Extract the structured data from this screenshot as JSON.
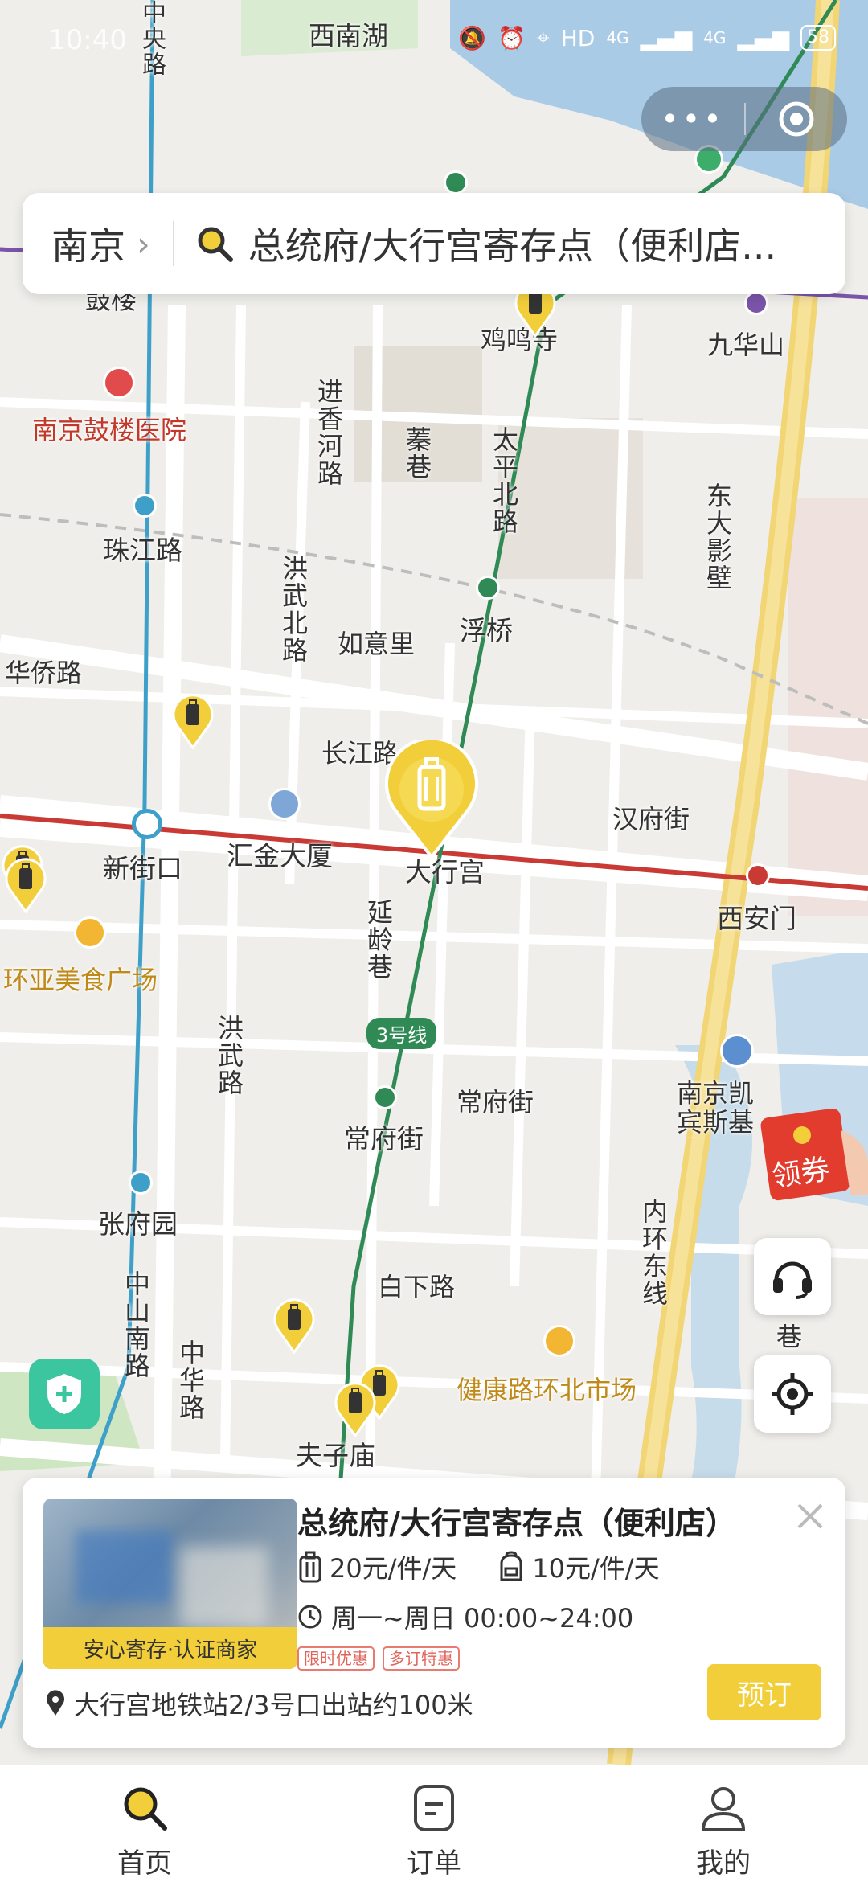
{
  "status_bar": {
    "time": "10:40",
    "network": "HD",
    "signal_a": "4G",
    "signal_b": "4G",
    "battery": "58"
  },
  "search": {
    "city": "南京",
    "query": "总统府/大行宫寄存点（便利店..."
  },
  "map_labels": {
    "xinanhu": "西南湖",
    "zhongyanglu": "中央路",
    "gulou": "鼓楼",
    "jimingsi": "鸡鸣寺",
    "jiuhuashan": "九华山",
    "gulou_hospital": "南京鼓楼医院",
    "jinxianghe": "进香河路",
    "qinxiang": "蓁巷",
    "taipingbei": "太平北路",
    "dongdayingbi": "东大影壁",
    "zhujianglu": "珠江路",
    "hongwubei": "洪武北路",
    "ruyili": "如意里",
    "fuqiao": "浮桥",
    "huaqiaolu": "华侨路",
    "changjianglu": "长江路",
    "hanfujie": "汉府街",
    "xinjiekou": "新街口",
    "huijin": "汇金大厦",
    "daxinggong": "大行宫",
    "xianmen": "西安门",
    "yanlingxiang": "延龄巷",
    "huanya": "环亚美食广场",
    "line3": "3号线",
    "hongwulu": "洪武路",
    "changfujie_road": "常府街",
    "changfujie_station": "常府街",
    "kempinski": "南京凯宾斯基酒店",
    "zhangfuyuan": "张府园",
    "neihuandong": "内环东线",
    "baixialu": "白下路",
    "zhongshannan": "中山南路",
    "zhonghualu": "中华路",
    "jiankanglu": "健康路环北市场",
    "fuzimiao": "夫子庙",
    "xiang": "巷"
  },
  "coupon": {
    "label": "领券"
  },
  "card": {
    "title": "总统府/大行宫寄存点（便利店）",
    "badge": "安心寄存·认证商家",
    "price_large": "20元/件/天",
    "price_small": "10元/件/天",
    "hours": "周一~周日 00:00~24:00",
    "tags": [
      "限时优惠",
      "多订特惠"
    ],
    "address": "大行宫地铁站2/3号口出站约100米",
    "book_label": "预订"
  },
  "tabs": [
    {
      "label": "首页",
      "icon": "search-icon",
      "active": true
    },
    {
      "label": "订单",
      "icon": "order-icon",
      "active": false
    },
    {
      "label": "我的",
      "icon": "user-icon",
      "active": false
    }
  ]
}
